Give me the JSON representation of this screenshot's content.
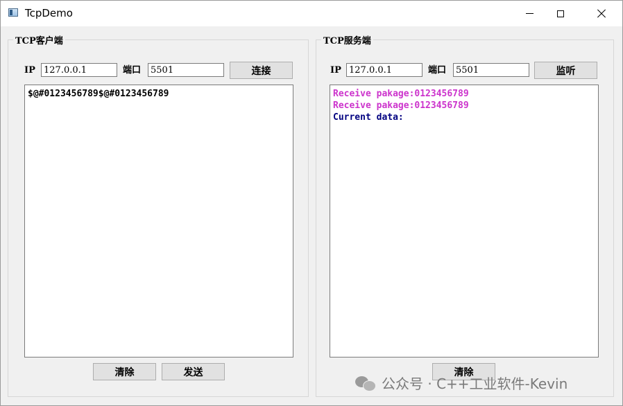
{
  "window": {
    "title": "TcpDemo"
  },
  "client": {
    "group_title": "TCP客户端",
    "ip_label": "IP",
    "ip_value": "127.0.0.1",
    "port_label": "端口",
    "port_value": "5501",
    "connect_label": "连接",
    "log": "$@#0123456789$@#0123456789",
    "clear_label": "清除",
    "send_label": "发送"
  },
  "server": {
    "group_title": "TCP服务端",
    "ip_label": "IP",
    "ip_value": "127.0.0.1",
    "port_label": "端口",
    "port_value": "5501",
    "listen_label": "监听",
    "log_lines": [
      {
        "text": "Receive pakage:0123456789",
        "color": "#cc33cc"
      },
      {
        "text": "Receive pakage:0123456789",
        "color": "#cc33cc"
      },
      {
        "text": "Current data:",
        "color": "#000080"
      }
    ],
    "clear_label": "清除"
  },
  "watermark": {
    "text": "公众号 · C++工业软件-Kevin"
  }
}
